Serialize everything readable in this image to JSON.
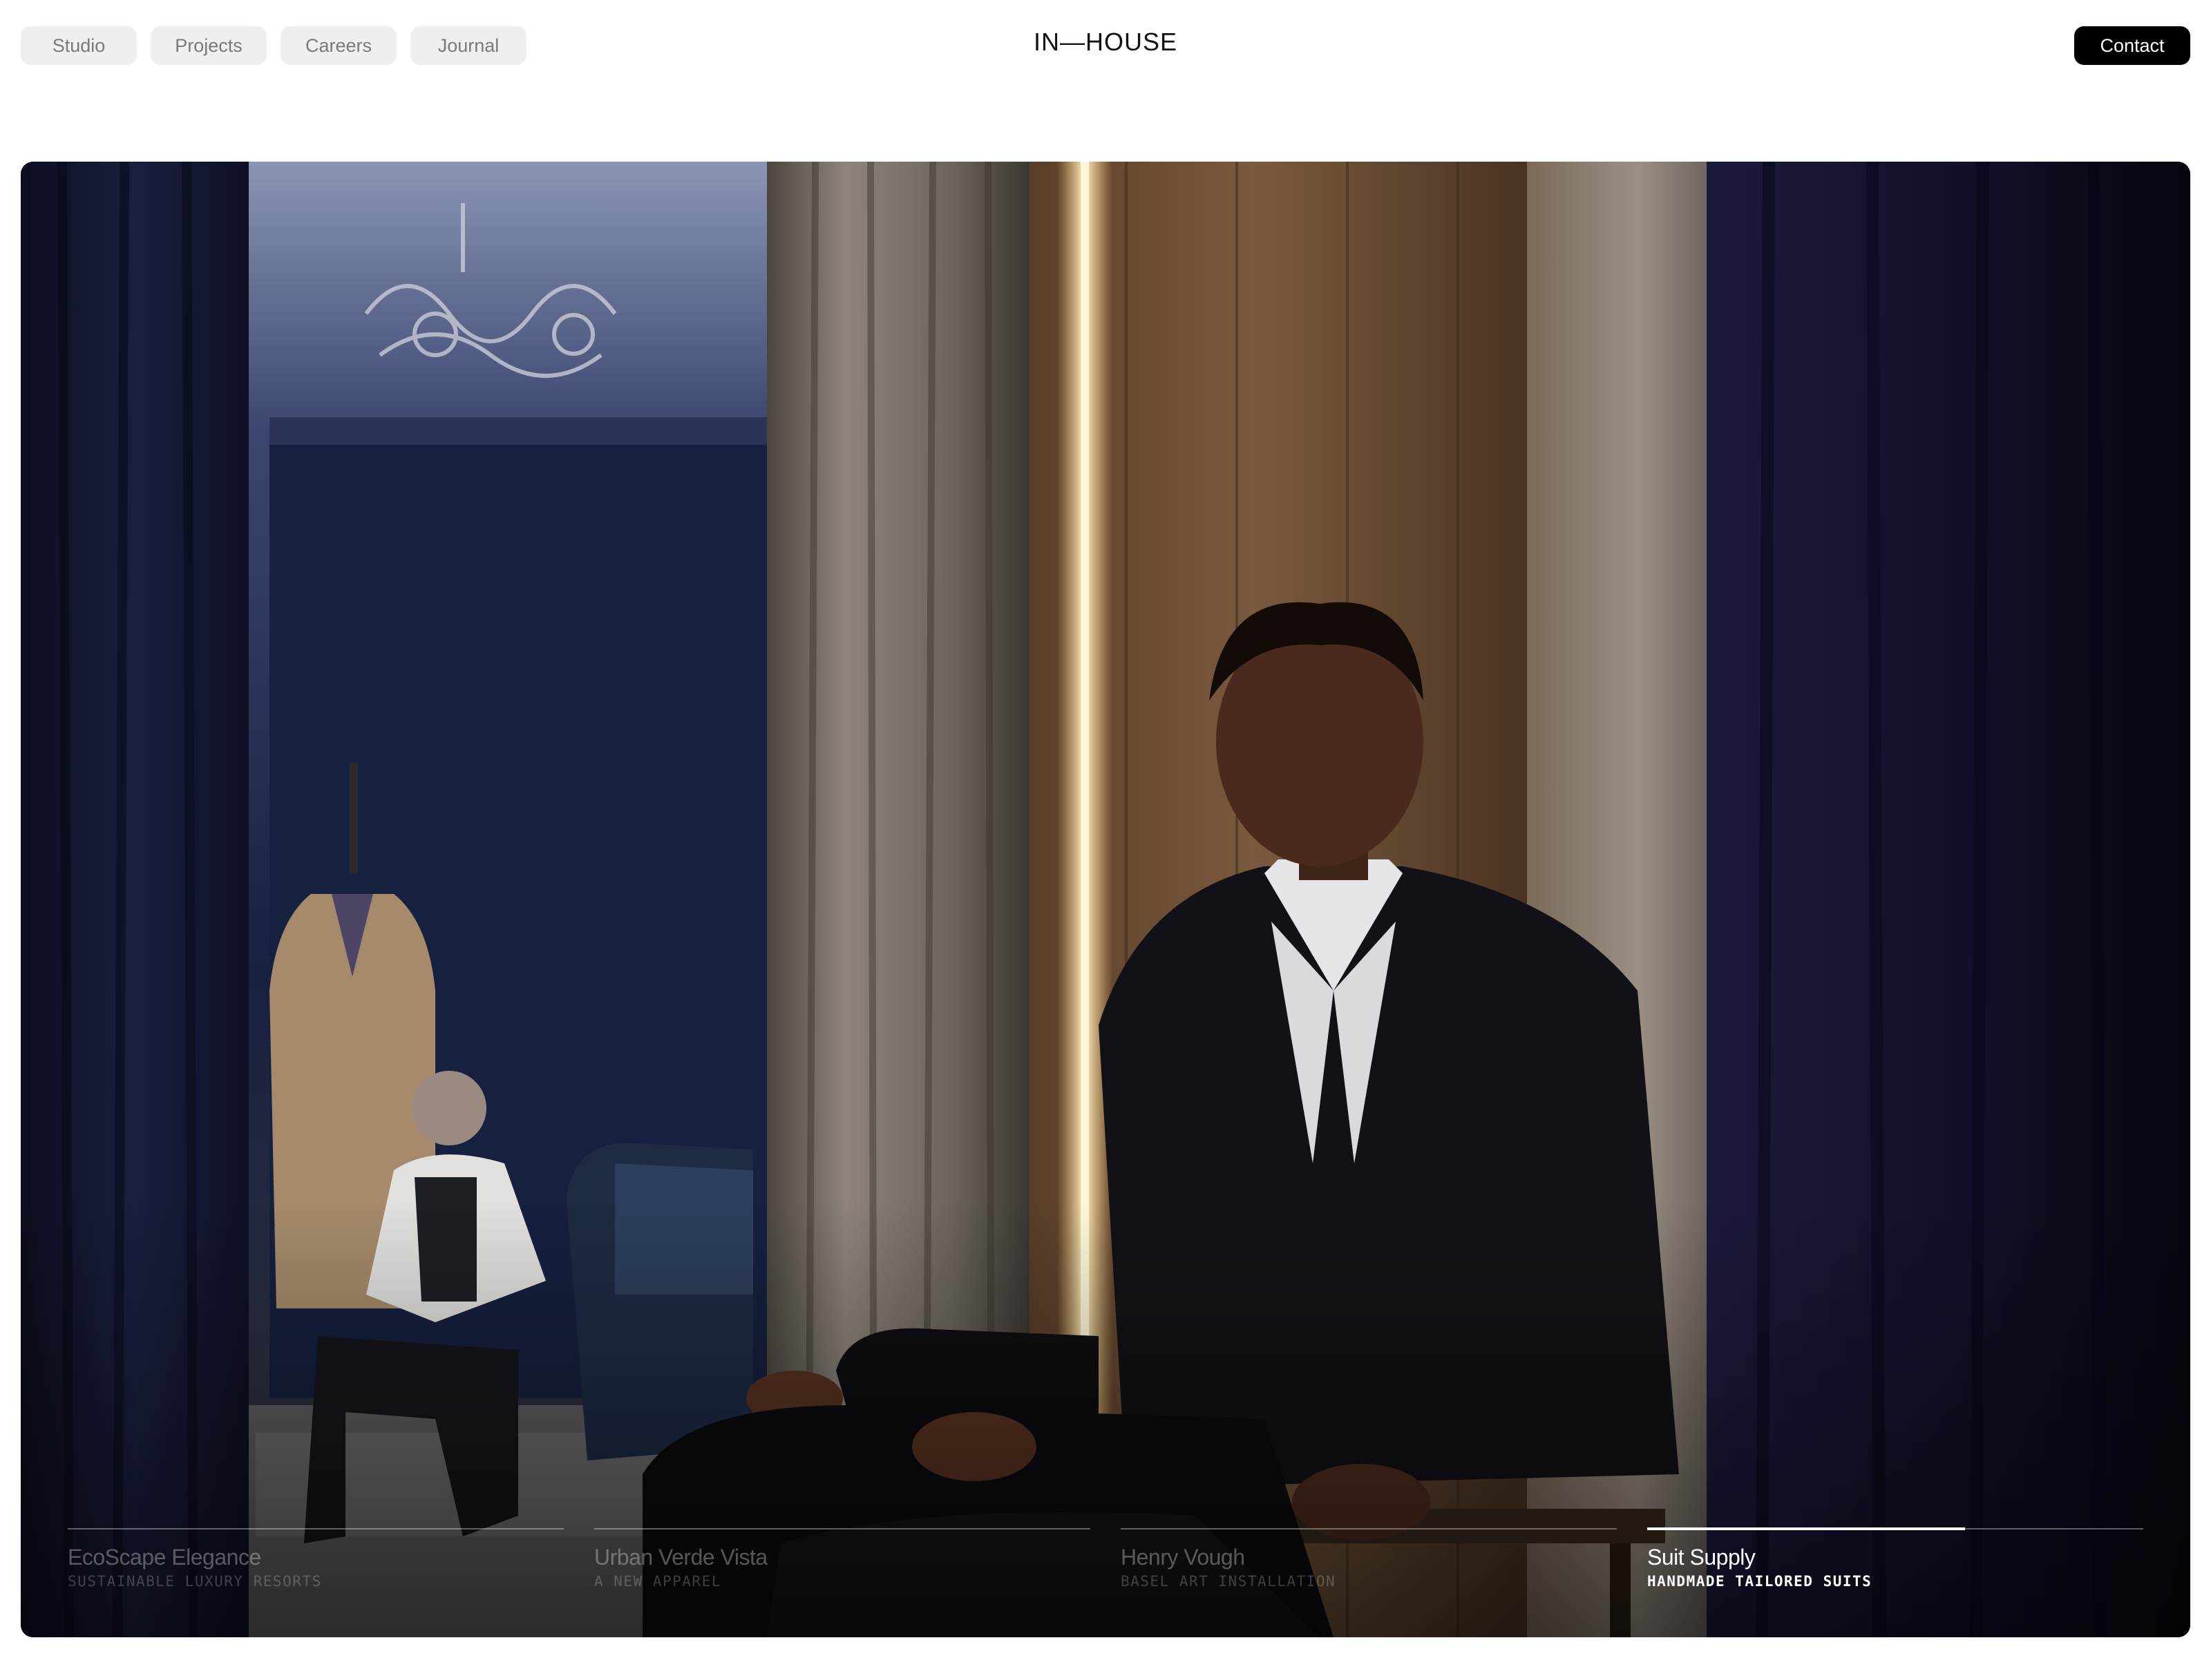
{
  "nav": {
    "items": [
      {
        "label": "Studio"
      },
      {
        "label": "Projects"
      },
      {
        "label": "Careers"
      },
      {
        "label": "Journal"
      }
    ]
  },
  "logo": "IN—HOUSE",
  "contact_label": "Contact",
  "hero": {
    "image_description_icon": "hero-video-icon",
    "slides": [
      {
        "title": "EcoScape Elegance",
        "subtitle": "SUSTAINABLE LUXURY RESORTS",
        "progress": 0,
        "active": false
      },
      {
        "title": "Urban Verde Vista",
        "subtitle": "A NEW APPAREL",
        "progress": 0,
        "active": false
      },
      {
        "title": "Henry Vough",
        "subtitle": "BASEL ART INSTALLATION",
        "progress": 0,
        "active": false
      },
      {
        "title": "Suit Supply",
        "subtitle": "HANDMADE TAILORED SUITS",
        "progress": 0.64,
        "active": true
      }
    ]
  },
  "colors": {
    "nav_bg": "#efefef",
    "nav_text": "#7a7a7a",
    "contact_bg": "#000000",
    "contact_text": "#ffffff"
  }
}
